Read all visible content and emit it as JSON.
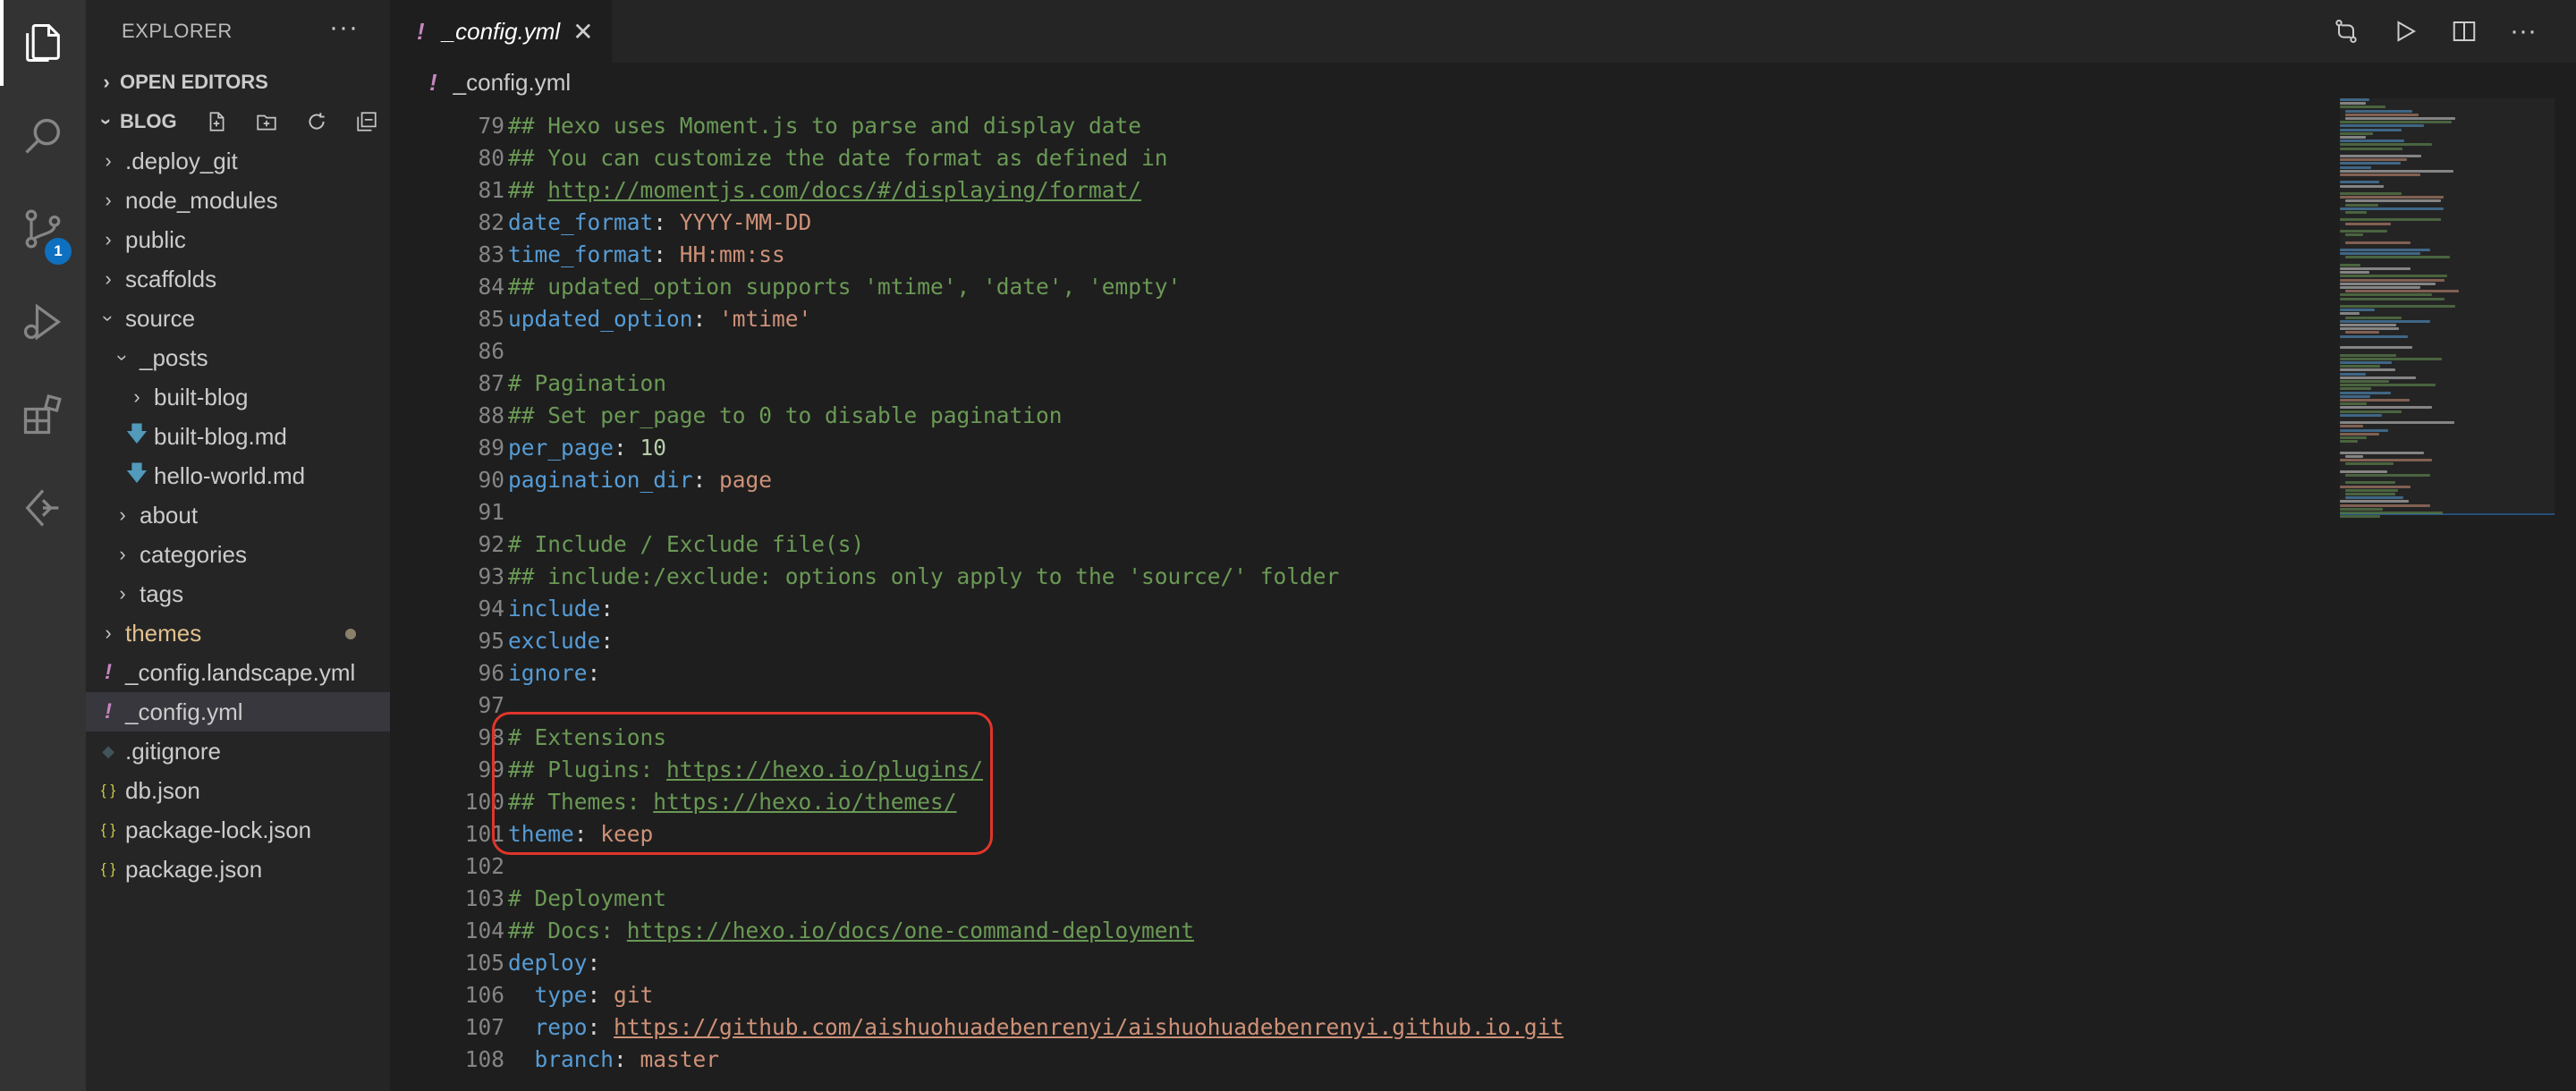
{
  "activity_bar": {
    "items": [
      {
        "name": "explorer-icon"
      },
      {
        "name": "search-icon"
      },
      {
        "name": "source-control-icon",
        "badge": "1"
      },
      {
        "name": "run-debug-icon"
      },
      {
        "name": "extensions-icon"
      },
      {
        "name": "remote-explorer-icon"
      }
    ]
  },
  "sidebar": {
    "title": "EXPLORER",
    "more": "···",
    "open_editors_label": "OPEN EDITORS",
    "workspace_label": "BLOG",
    "tree": [
      {
        "label": ".deploy_git",
        "kind": "folder",
        "open": false,
        "depth": 1
      },
      {
        "label": "node_modules",
        "kind": "folder",
        "open": false,
        "depth": 1
      },
      {
        "label": "public",
        "kind": "folder",
        "open": false,
        "depth": 1
      },
      {
        "label": "scaffolds",
        "kind": "folder",
        "open": false,
        "depth": 1
      },
      {
        "label": "source",
        "kind": "folder",
        "open": true,
        "depth": 1
      },
      {
        "label": "_posts",
        "kind": "folder",
        "open": true,
        "depth": 2
      },
      {
        "label": "built-blog",
        "kind": "folder",
        "open": false,
        "depth": 3
      },
      {
        "label": "built-blog.md",
        "kind": "md",
        "depth": 3
      },
      {
        "label": "hello-world.md",
        "kind": "md",
        "depth": 3
      },
      {
        "label": "about",
        "kind": "folder",
        "open": false,
        "depth": 2
      },
      {
        "label": "categories",
        "kind": "folder",
        "open": false,
        "depth": 2
      },
      {
        "label": "tags",
        "kind": "folder",
        "open": false,
        "depth": 2
      },
      {
        "label": "themes",
        "kind": "folder",
        "open": false,
        "depth": 1,
        "modified": true
      },
      {
        "label": "_config.landscape.yml",
        "kind": "yml",
        "depth": 1
      },
      {
        "label": "_config.yml",
        "kind": "yml",
        "depth": 1,
        "selected": true
      },
      {
        "label": ".gitignore",
        "kind": "git",
        "depth": 1
      },
      {
        "label": "db.json",
        "kind": "json",
        "depth": 1
      },
      {
        "label": "package-lock.json",
        "kind": "json",
        "depth": 1
      },
      {
        "label": "package.json",
        "kind": "json",
        "depth": 1
      }
    ]
  },
  "editor": {
    "tab_label": "_config.yml",
    "tab_bang": "!",
    "breadcrumb": "_config.yml",
    "colors": {
      "comment": "#6a9955",
      "key": "#569cd6",
      "value": "#ce9178",
      "number": "#b5cea8",
      "highlight": "#e0352b"
    },
    "lines": [
      {
        "n": "79",
        "tokens": [
          [
            "c-comment",
            "## Hexo uses Moment.js to parse and display date"
          ]
        ]
      },
      {
        "n": "80",
        "tokens": [
          [
            "c-comment",
            "## You can customize the date format as defined in"
          ]
        ]
      },
      {
        "n": "81",
        "tokens": [
          [
            "c-comment",
            "## "
          ],
          [
            "c-link",
            "http://momentjs.com/docs/#/displaying/format/"
          ]
        ]
      },
      {
        "n": "82",
        "tokens": [
          [
            "c-key",
            "date_format"
          ],
          [
            "c-plain",
            ": "
          ],
          [
            "c-val",
            "YYYY-MM-DD"
          ]
        ]
      },
      {
        "n": "83",
        "tokens": [
          [
            "c-key",
            "time_format"
          ],
          [
            "c-plain",
            ": "
          ],
          [
            "c-val",
            "HH:mm:ss"
          ]
        ]
      },
      {
        "n": "84",
        "tokens": [
          [
            "c-comment",
            "## updated_option supports 'mtime', 'date', 'empty'"
          ]
        ]
      },
      {
        "n": "85",
        "tokens": [
          [
            "c-key",
            "updated_option"
          ],
          [
            "c-plain",
            ": "
          ],
          [
            "c-val",
            "'mtime'"
          ]
        ]
      },
      {
        "n": "86",
        "tokens": []
      },
      {
        "n": "87",
        "tokens": [
          [
            "c-comment",
            "# Pagination"
          ]
        ]
      },
      {
        "n": "88",
        "tokens": [
          [
            "c-comment",
            "## Set per_page to 0 to disable pagination"
          ]
        ]
      },
      {
        "n": "89",
        "tokens": [
          [
            "c-key",
            "per_page"
          ],
          [
            "c-plain",
            ": "
          ],
          [
            "c-num",
            "10"
          ]
        ]
      },
      {
        "n": "90",
        "tokens": [
          [
            "c-key",
            "pagination_dir"
          ],
          [
            "c-plain",
            ": "
          ],
          [
            "c-val",
            "page"
          ]
        ]
      },
      {
        "n": "91",
        "tokens": []
      },
      {
        "n": "92",
        "tokens": [
          [
            "c-comment",
            "# Include / Exclude file(s)"
          ]
        ]
      },
      {
        "n": "93",
        "tokens": [
          [
            "c-comment",
            "## include:/exclude: options only apply to the 'source/' folder"
          ]
        ]
      },
      {
        "n": "94",
        "tokens": [
          [
            "c-key",
            "include"
          ],
          [
            "c-plain",
            ":"
          ]
        ]
      },
      {
        "n": "95",
        "tokens": [
          [
            "c-key",
            "exclude"
          ],
          [
            "c-plain",
            ":"
          ]
        ]
      },
      {
        "n": "96",
        "tokens": [
          [
            "c-key",
            "ignore"
          ],
          [
            "c-plain",
            ":"
          ]
        ]
      },
      {
        "n": "97",
        "tokens": []
      },
      {
        "n": "98",
        "tokens": [
          [
            "c-comment",
            "# Extensions"
          ]
        ]
      },
      {
        "n": "99",
        "tokens": [
          [
            "c-comment",
            "## Plugins: "
          ],
          [
            "c-link",
            "https://hexo.io/plugins/"
          ]
        ]
      },
      {
        "n": "100",
        "tokens": [
          [
            "c-comment",
            "## Themes: "
          ],
          [
            "c-link",
            "https://hexo.io/themes/"
          ]
        ]
      },
      {
        "n": "101",
        "tokens": [
          [
            "c-key",
            "theme"
          ],
          [
            "c-plain",
            ": "
          ],
          [
            "c-val",
            "keep"
          ]
        ]
      },
      {
        "n": "102",
        "tokens": []
      },
      {
        "n": "103",
        "tokens": [
          [
            "c-comment",
            "# Deployment"
          ]
        ]
      },
      {
        "n": "104",
        "tokens": [
          [
            "c-comment",
            "## Docs: "
          ],
          [
            "c-link",
            "https://hexo.io/docs/one-command-deployment"
          ]
        ]
      },
      {
        "n": "105",
        "tokens": [
          [
            "c-key",
            "deploy"
          ],
          [
            "c-plain",
            ":"
          ]
        ]
      },
      {
        "n": "106",
        "tokens": [
          [
            "c-plain",
            "  "
          ],
          [
            "c-key",
            "type"
          ],
          [
            "c-plain",
            ": "
          ],
          [
            "c-val",
            "git"
          ]
        ]
      },
      {
        "n": "107",
        "tokens": [
          [
            "c-plain",
            "  "
          ],
          [
            "c-key",
            "repo"
          ],
          [
            "c-plain",
            ": "
          ],
          [
            "c-link-val",
            "https://github.com/aishuohuadebenrenyi/aishuohuadebenrenyi.github.io.git"
          ]
        ]
      },
      {
        "n": "108",
        "tokens": [
          [
            "c-plain",
            "  "
          ],
          [
            "c-key",
            "branch"
          ],
          [
            "c-plain",
            ": "
          ],
          [
            "c-val",
            "master"
          ]
        ]
      }
    ]
  }
}
